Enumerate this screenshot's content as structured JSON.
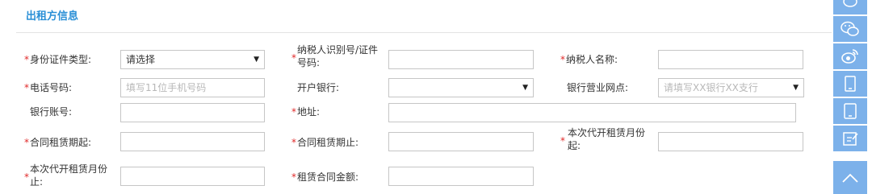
{
  "section": {
    "title": "出租方信息"
  },
  "form": {
    "id_type": {
      "label": "身份证件类型:",
      "required": true,
      "value": "请选择"
    },
    "taxpayer_id": {
      "label_line1": "纳税人识别号/证件",
      "label_line2": "号码:",
      "required": true,
      "value": ""
    },
    "taxpayer_name": {
      "label": "纳税人名称:",
      "required": true,
      "value": ""
    },
    "phone": {
      "label": "电话号码:",
      "required": true,
      "placeholder": "填写11位手机号码"
    },
    "bank": {
      "label": "开户银行:",
      "required": false,
      "value": ""
    },
    "bank_branch": {
      "label": "银行营业网点:",
      "required": false,
      "placeholder": "请填写XX银行XX支行"
    },
    "bank_account": {
      "label": "银行账号:",
      "required": false,
      "value": ""
    },
    "address": {
      "label": "地址:",
      "required": true,
      "value": ""
    },
    "contract_start": {
      "label": "合同租赁期起:",
      "required": true,
      "value": ""
    },
    "contract_end": {
      "label": "合同租赁期止:",
      "required": true,
      "value": ""
    },
    "invoice_month_from": {
      "label_line1": "本次代开租赁月份",
      "label_line2": "起:",
      "required": true,
      "value": ""
    },
    "invoice_month_to": {
      "label_line1": "本次代开租赁月份",
      "label_line2": "止:",
      "required": true,
      "value": ""
    },
    "contract_amount": {
      "label": "租赁合同金额:",
      "required": true,
      "value": ""
    }
  },
  "required_marker": "*",
  "toolbar": {
    "items": [
      {
        "icon": "chat-bubble-icon"
      },
      {
        "icon": "wechat-icon"
      },
      {
        "icon": "weibo-icon"
      },
      {
        "icon": "mobile-phone-icon"
      },
      {
        "icon": "tablet-icon"
      },
      {
        "icon": "edit-feedback-icon"
      },
      {
        "icon": "back-to-top-icon"
      }
    ],
    "color": "#7cb1ea"
  },
  "colors": {
    "accent": "#2a8fd6",
    "required": "#e12a2a",
    "border": "#c6c6c6",
    "placeholder": "#b8b8b8"
  }
}
